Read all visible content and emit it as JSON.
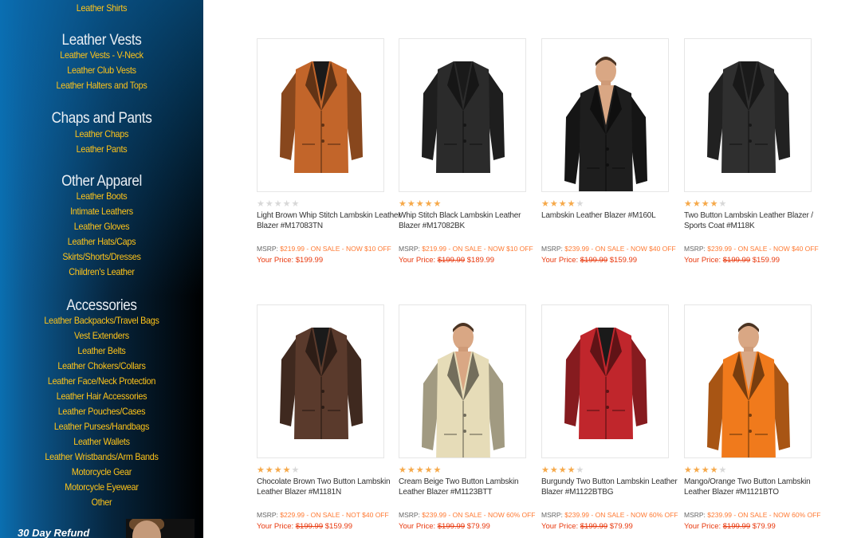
{
  "sidebar": {
    "top_link": "Leather Shirts",
    "sections": [
      {
        "title": "Leather Vests",
        "links": [
          "Leather Vests - V-Neck",
          "Leather Club Vests",
          "Leather Halters and Tops"
        ]
      },
      {
        "title": "Chaps and Pants",
        "links": [
          "Leather Chaps",
          "Leather Pants"
        ]
      },
      {
        "title": "Other Apparel",
        "links": [
          "Leather Boots",
          "Intimate Leathers",
          "Leather Gloves",
          "Leather Hats/Caps",
          "Skirts/Shorts/Dresses",
          "Children's Leather"
        ]
      },
      {
        "title": "Accessories",
        "links": [
          "Leather Backpacks/Travel Bags",
          "Vest Extenders",
          "Leather Belts",
          "Leather Chokers/Collars",
          "Leather Face/Neck Protection",
          "Leather Hair Accessories",
          "Leather Pouches/Cases",
          "Leather Purses/Handbags",
          "Leather Wallets",
          "Leather Wristbands/Arm Bands",
          "Motorcycle Gear",
          "Motorcycle Eyewear",
          "Other"
        ]
      }
    ],
    "refund_text": "30 Day Refund"
  },
  "products": [
    {
      "name": "Light Brown Whip Stitch Lambskin Leather Blazer #M17083TN",
      "rating": 0,
      "msrp_label": "MSRP:",
      "msrp": "$219.99",
      "sale_text": "- ON SALE - NOW $10 OFF",
      "price_label": "Your Price:",
      "old_price": "",
      "price": "$199.99",
      "image": "jacket-photo",
      "jacket_color": "#c2652a",
      "has_model": false
    },
    {
      "name": "Whip Stitch Black Lambskin Leather Blazer #M17082BK",
      "rating": 5,
      "msrp_label": "MSRP:",
      "msrp": "$219.99",
      "sale_text": "- ON SALE - NOW $10 OFF",
      "price_label": "Your Price:",
      "old_price": "$199.99",
      "price": "$189.99",
      "image": "jacket-photo",
      "jacket_color": "#2b2b2b",
      "has_model": false
    },
    {
      "name": "Lambskin Leather Blazer #M160L",
      "rating": 4,
      "msrp_label": "MSRP:",
      "msrp": "$239.99",
      "sale_text": "- ON SALE - NOW $40 OFF",
      "price_label": "Your Price:",
      "old_price": "$199.99",
      "price": "$159.99",
      "image": "model-photo",
      "jacket_color": "#1e1e1e",
      "has_model": true
    },
    {
      "name": "Two Button Lambskin Leather Blazer / Sports Coat #M118K",
      "rating": 4,
      "msrp_label": "MSRP:",
      "msrp": "$239.99",
      "sale_text": "- ON SALE - NOW $40 OFF",
      "price_label": "Your Price:",
      "old_price": "$199.99",
      "price": "$159.99",
      "image": "jacket-photo",
      "jacket_color": "#2f2f2f",
      "has_model": false
    },
    {
      "name": "Chocolate Brown Two Button Lambskin Leather Blazer #M1181N",
      "rating": 4,
      "msrp_label": "MSRP:",
      "msrp": "$229.99",
      "sale_text": "- ON SALE - NOT $40 OFF",
      "price_label": "Your Price:",
      "old_price": "$199.99",
      "price": "$159.99",
      "image": "jacket-photo",
      "jacket_color": "#5a3a2c",
      "has_model": false
    },
    {
      "name": "Cream Beige Two Button Lambskin Leather Blazer #M1123BTT",
      "rating": 5,
      "msrp_label": "MSRP:",
      "msrp": "$239.99",
      "sale_text": "- ON SALE - NOW 60% OFF",
      "price_label": "Your Price:",
      "old_price": "$199.99",
      "price": "$79.99",
      "image": "model-photo",
      "jacket_color": "#e6dcb8",
      "has_model": true
    },
    {
      "name": "Burgundy Two Button Lambskin Leather Blazer #M1122BTBG",
      "rating": 4,
      "msrp_label": "MSRP:",
      "msrp": "$239.99",
      "sale_text": "- ON SALE - NOW 60% OFF",
      "price_label": "Your Price:",
      "old_price": "$199.99",
      "price": "$79.99",
      "image": "jacket-photo",
      "jacket_color": "#c0262c",
      "has_model": false
    },
    {
      "name": "Mango/Orange Two Button Lambskin Leather Blazer #M1121BTO",
      "rating": 4,
      "msrp_label": "MSRP:",
      "msrp": "$239.99",
      "sale_text": "- ON SALE - NOW 60% OFF",
      "price_label": "Your Price:",
      "old_price": "$199.99",
      "price": "$79.99",
      "image": "model-photo",
      "jacket_color": "#f07a1c",
      "has_model": true
    }
  ],
  "colors": {
    "link": "#ffc41a",
    "sale": "#ff7a33",
    "price": "#e8380d",
    "star_on": "#f6a94a",
    "star_off": "#d8d8d8"
  }
}
